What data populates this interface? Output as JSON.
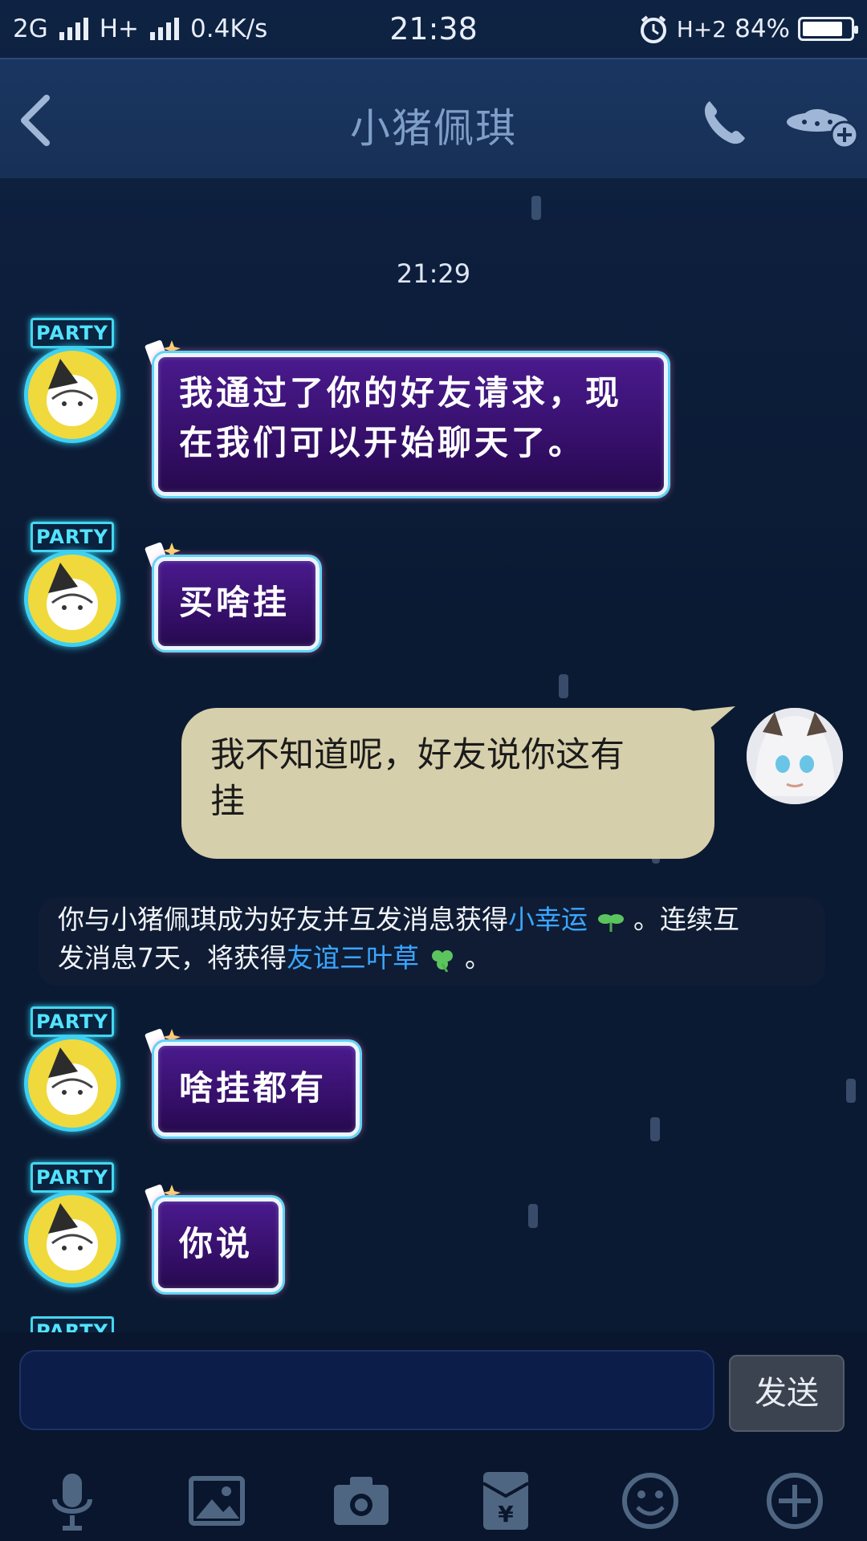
{
  "status_bar": {
    "network1": "2G",
    "network2": "H+",
    "speed": "0.4K/s",
    "time": "21:38",
    "network3": "H+2",
    "battery": "84%",
    "battery_level": 0.84
  },
  "header": {
    "title": "小猪佩琪",
    "icons": [
      "back-arrow-icon",
      "phone-icon",
      "ufo-add-icon"
    ]
  },
  "chat": {
    "timestamp": "21:29",
    "party_label": "PARTY",
    "messages": [
      {
        "sender": "them",
        "text_line1": "我通过了你的好友请求，现",
        "text_line2": "在我们可以开始聊天了。"
      },
      {
        "sender": "them",
        "text": "买啥挂"
      },
      {
        "sender": "me",
        "text_line1": "我不知道呢，好友说你这有",
        "text_line2": "挂"
      },
      {
        "sender": "them",
        "text": "啥挂都有"
      },
      {
        "sender": "them",
        "text": "你说"
      }
    ],
    "system": {
      "part1": "你与小猪佩琪成为好友并互发消息获得",
      "highlight1": "小幸运",
      "part2": "。连续互",
      "part3": "发消息7天，将获得",
      "highlight2": "友谊三叶草",
      "part4": "。"
    }
  },
  "input": {
    "placeholder": "",
    "send_label": "发送"
  },
  "toolbar": {
    "icons": [
      "microphone-icon",
      "image-icon",
      "camera-icon",
      "red-packet-icon",
      "emoji-icon",
      "plus-icon"
    ]
  },
  "colors": {
    "background": "#0b1a33",
    "header": "#173057",
    "bubble_me": "#d6cfab",
    "bubble_them": "#2f0c5e",
    "highlight": "#3aa6ff",
    "party_neon": "#43d7f0"
  }
}
